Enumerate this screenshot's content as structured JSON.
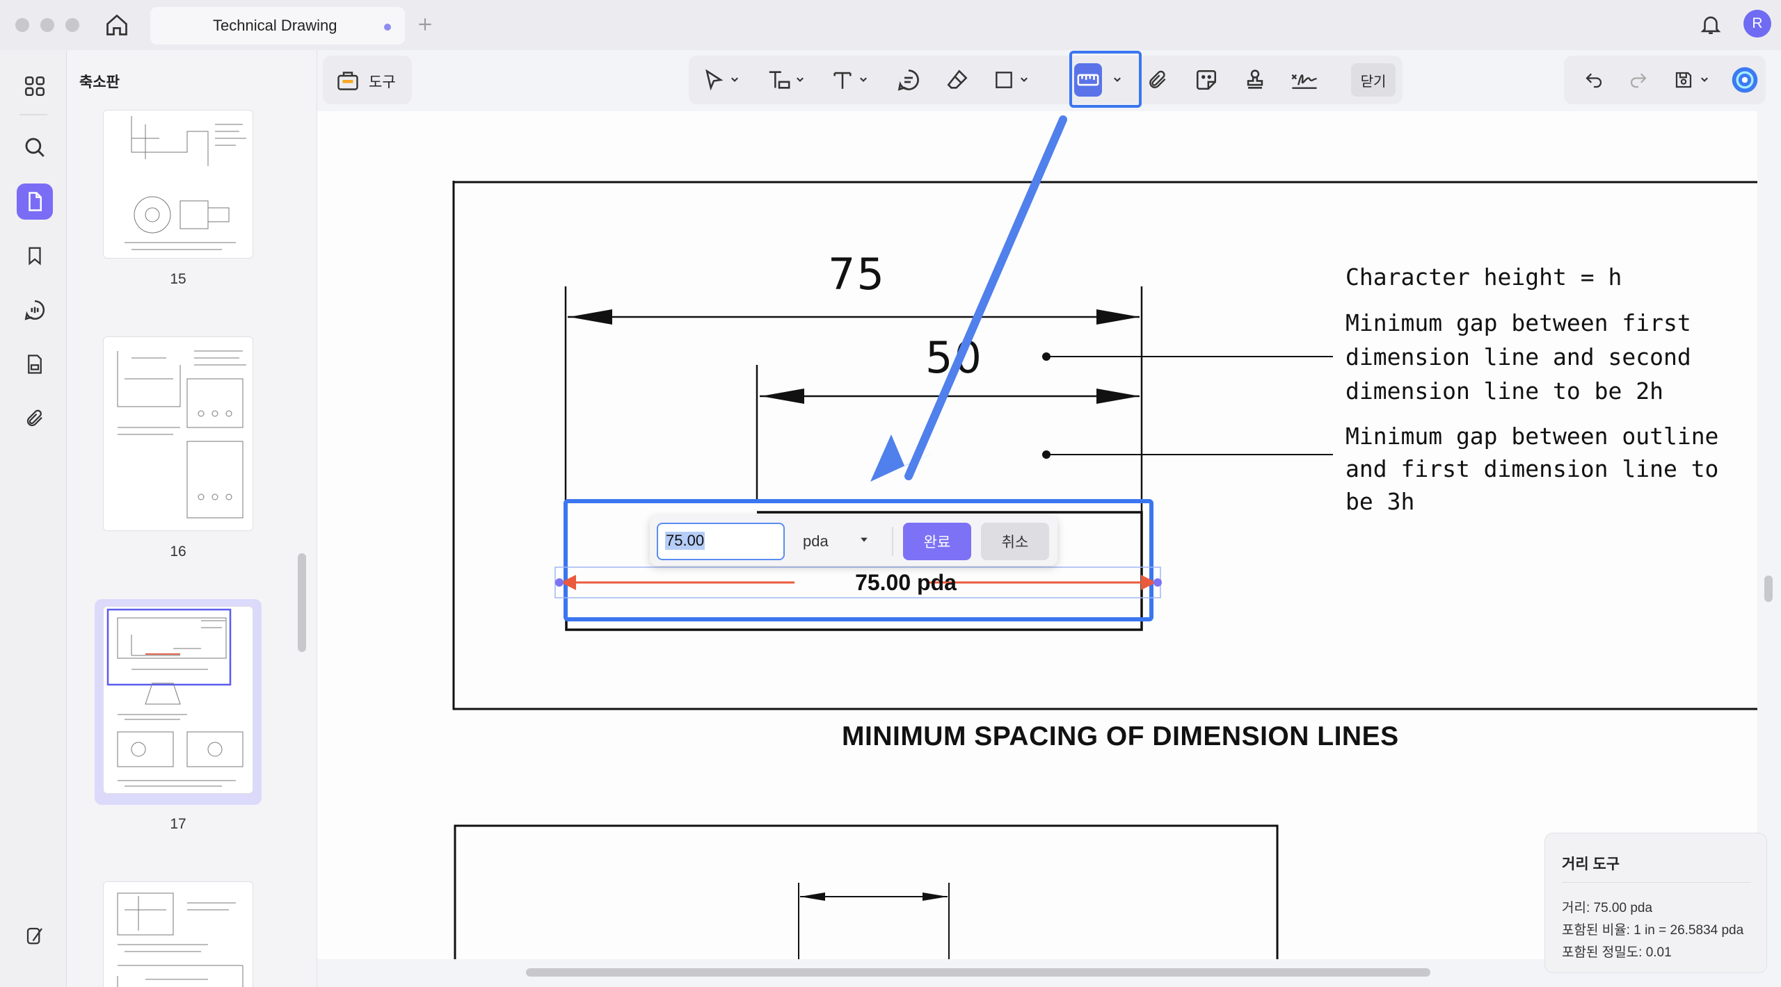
{
  "window": {
    "tab_title": "Technical Drawing",
    "avatar_letter": "R"
  },
  "left_panel": {
    "title": "축소판",
    "pages": [
      "15",
      "16",
      "17"
    ]
  },
  "toolbar": {
    "tools_label": "도구",
    "close_label": "닫기"
  },
  "drawing": {
    "dim_top": "75",
    "dim_second": "50",
    "note1": [
      "Character height = h"
    ],
    "note2": [
      "Minimum gap between first",
      "dimension line and second",
      "dimension line to be 2h"
    ],
    "note3": [
      "Minimum gap between outline",
      "and first dimension line to",
      "be 3h"
    ],
    "caption": "MINIMUM SPACING OF DIMENSION LINES",
    "measurement_label": "75.00 pda"
  },
  "measure_popup": {
    "value": "75.00",
    "unit": "pda",
    "done_label": "완료",
    "cancel_label": "취소"
  },
  "info_panel": {
    "title": "거리 도구",
    "distance": "거리: 75.00 pda",
    "scale": "포함된 비율: 1 in = 26.5834 pda",
    "precision": "포함된 정밀도: 0.01"
  },
  "colors": {
    "accent": "#7b6cf6",
    "highlight_blue": "#3b76f0",
    "measure_red": "#ea5a3c"
  }
}
